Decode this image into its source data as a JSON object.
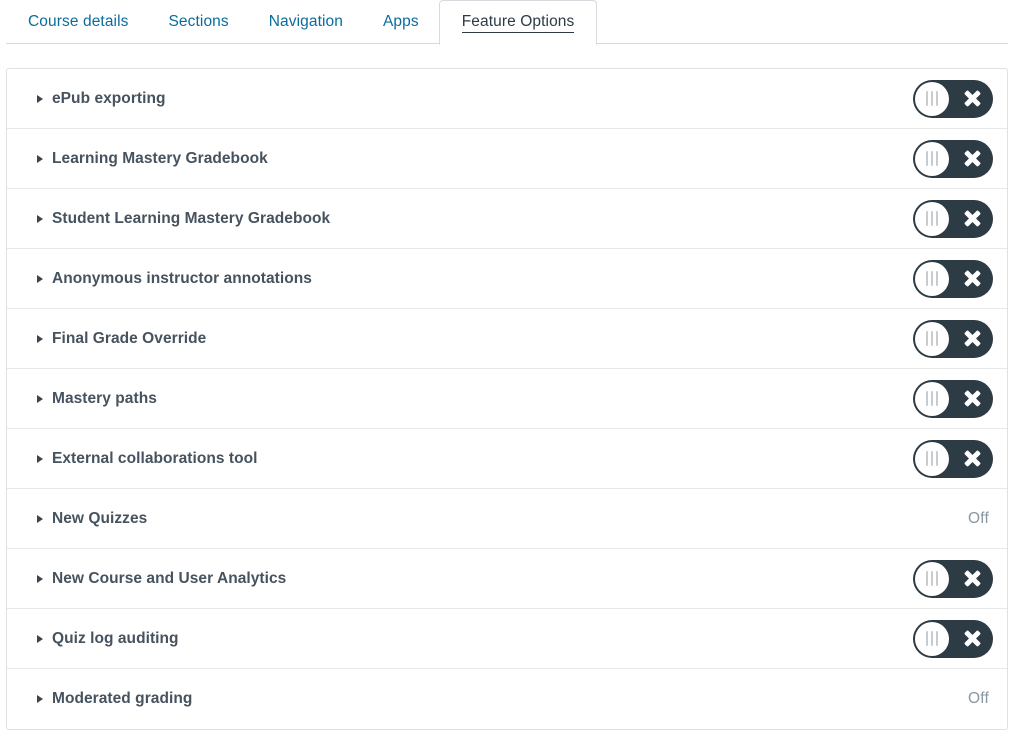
{
  "tabs": [
    {
      "label": "Course details",
      "active": false
    },
    {
      "label": "Sections",
      "active": false
    },
    {
      "label": "Navigation",
      "active": false
    },
    {
      "label": "Apps",
      "active": false
    },
    {
      "label": "Feature Options",
      "active": true
    }
  ],
  "colors": {
    "tab_link": "#0a6c9e",
    "tab_active_text": "#2d3b45",
    "toggle_track": "#2d3b45",
    "toggle_knob": "#ffffff",
    "label_text": "#46535e",
    "state_text": "#8b969e",
    "row_border": "#e6e8ea",
    "panel_border": "#dfe2e5"
  },
  "features": [
    {
      "label": "ePub exporting",
      "control": "toggle",
      "state": ""
    },
    {
      "label": "Learning Mastery Gradebook",
      "control": "toggle",
      "state": ""
    },
    {
      "label": "Student Learning Mastery Gradebook",
      "control": "toggle",
      "state": ""
    },
    {
      "label": "Anonymous instructor annotations",
      "control": "toggle",
      "state": ""
    },
    {
      "label": "Final Grade Override",
      "control": "toggle",
      "state": ""
    },
    {
      "label": "Mastery paths",
      "control": "toggle",
      "state": ""
    },
    {
      "label": "External collaborations tool",
      "control": "toggle",
      "state": ""
    },
    {
      "label": "New Quizzes",
      "control": "text",
      "state": "Off"
    },
    {
      "label": "New Course and User Analytics",
      "control": "toggle",
      "state": ""
    },
    {
      "label": "Quiz log auditing",
      "control": "toggle",
      "state": ""
    },
    {
      "label": "Moderated grading",
      "control": "text",
      "state": "Off"
    }
  ]
}
